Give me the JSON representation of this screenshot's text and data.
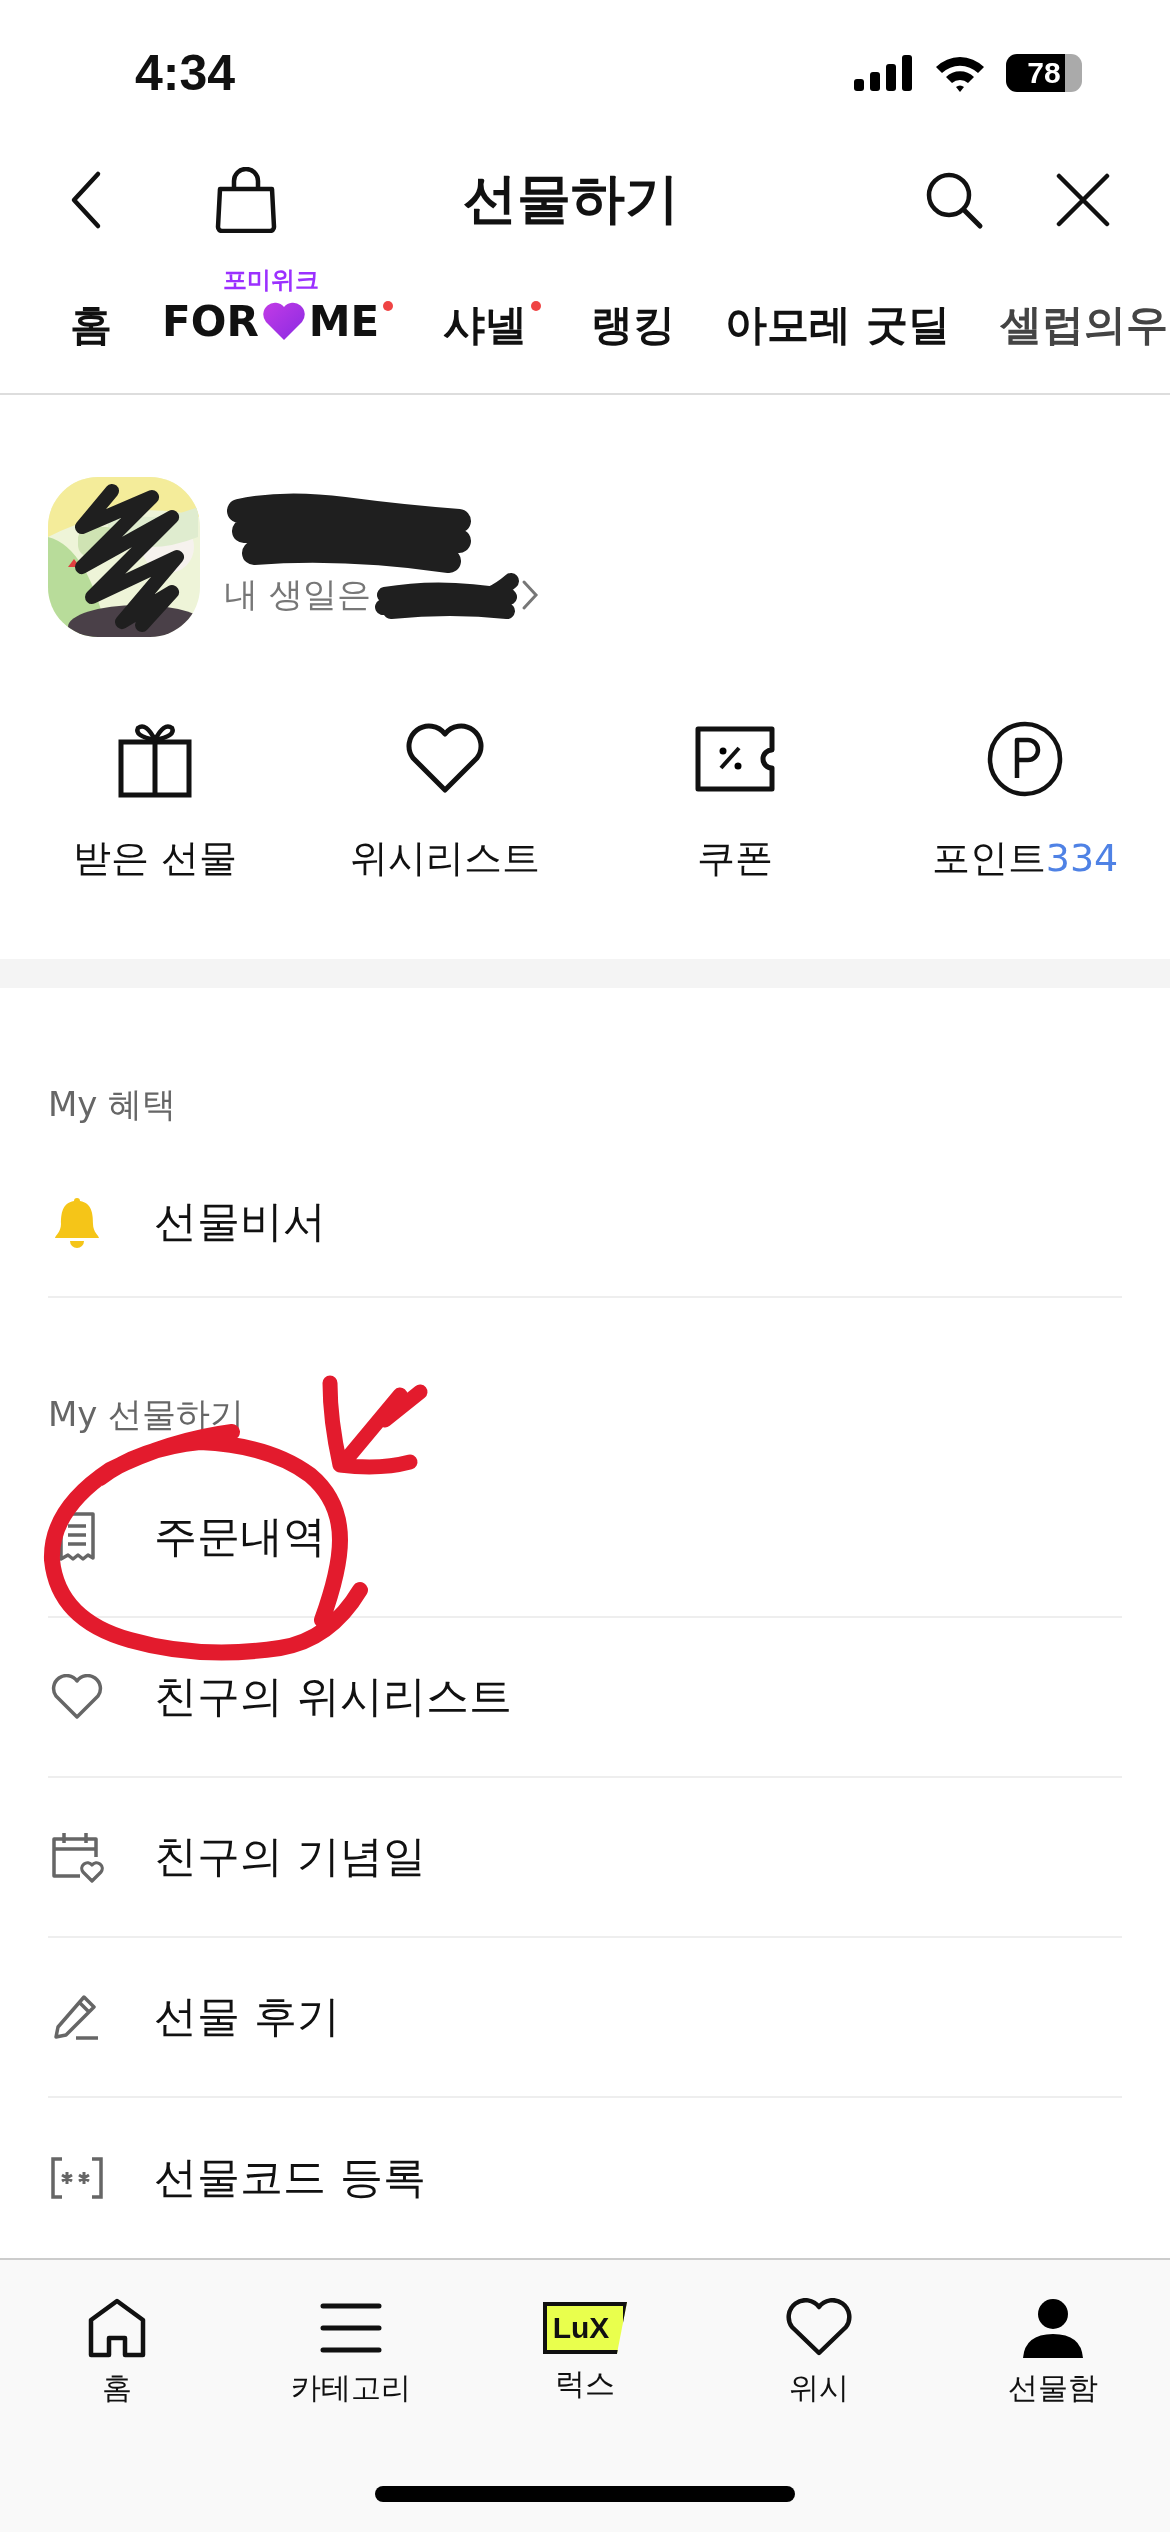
{
  "status_bar": {
    "time": "4:34",
    "battery": "78"
  },
  "header": {
    "title": "선물하기"
  },
  "tabs": [
    {
      "kind": "text",
      "label": "홈",
      "dot": false
    },
    {
      "kind": "forme",
      "caption": "포미위크",
      "label_left": "FOR",
      "label_right": "ME",
      "dot": true
    },
    {
      "kind": "text",
      "label": "샤넬",
      "dot": true
    },
    {
      "kind": "text",
      "label": "랭킹",
      "dot": false
    },
    {
      "kind": "text",
      "label": "아모레 굿딜",
      "dot": false
    },
    {
      "kind": "text",
      "label": "셀럽의우",
      "dot": false
    }
  ],
  "profile": {
    "birthday_label": "내 생일은"
  },
  "quick_menu": [
    {
      "kind": "gift",
      "label": "받은 선물"
    },
    {
      "kind": "heart",
      "label": "위시리스트"
    },
    {
      "kind": "coupon",
      "label": "쿠폰"
    },
    {
      "kind": "point",
      "label": "포인트",
      "value": "334"
    }
  ],
  "sections": [
    {
      "title": "My 혜택",
      "items": [
        {
          "kind": "bell",
          "label": "선물비서"
        }
      ]
    },
    {
      "title": "My 선물하기",
      "items": [
        {
          "kind": "receipt",
          "label": "주문내역"
        },
        {
          "kind": "heart",
          "label": "친구의 위시리스트"
        },
        {
          "kind": "calendar",
          "label": "친구의 기념일"
        },
        {
          "kind": "pencil",
          "label": "선물 후기"
        },
        {
          "kind": "code",
          "label": "선물코드 등록"
        }
      ]
    }
  ],
  "bottom_nav": [
    {
      "kind": "home",
      "label": "홈"
    },
    {
      "kind": "menu",
      "label": "카테고리"
    },
    {
      "kind": "lux",
      "label": "럭스",
      "logo_text": "LuX"
    },
    {
      "kind": "heart",
      "label": "위시"
    },
    {
      "kind": "person",
      "label": "선물함"
    }
  ]
}
